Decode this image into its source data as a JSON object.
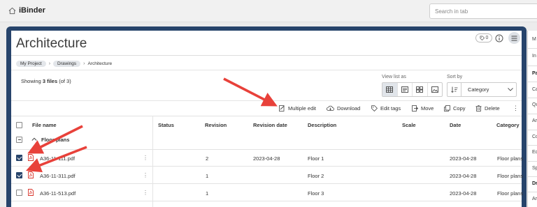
{
  "app": {
    "logo_text": "iBinder"
  },
  "search": {
    "placeholder": "Search in tab"
  },
  "page": {
    "title": "Architecture",
    "tag_count": "0"
  },
  "breadcrumb": [
    "My Project",
    "Drawings",
    "Architecture"
  ],
  "summary": {
    "prefix": "Showing ",
    "count": "3 files",
    "suffix": " (of 3)"
  },
  "view": {
    "label": "View list as"
  },
  "sort": {
    "label": "Sort by",
    "value": "Category"
  },
  "toolbar": {
    "multiple_edit": "Multiple edit",
    "download": "Download",
    "edit_tags": "Edit tags",
    "move": "Move",
    "copy": "Copy",
    "delete": "Delete"
  },
  "table": {
    "headers": {
      "file_name": "File name",
      "status": "Status",
      "revision": "Revision",
      "revision_date": "Revision date",
      "description": "Description",
      "scale": "Scale",
      "date": "Date",
      "category": "Category"
    },
    "group": "Floor plans",
    "rows": [
      {
        "file": "A36-11-111.pdf",
        "status": "",
        "revision": "2",
        "revision_date": "2023-04-28",
        "description": "Floor 1",
        "scale": "",
        "date": "2023-04-28",
        "category": "Floor plans",
        "checked": true
      },
      {
        "file": "A36-11-311.pdf",
        "status": "",
        "revision": "1",
        "revision_date": "",
        "description": "Floor 2",
        "scale": "",
        "date": "2023-04-28",
        "category": "Floor plans",
        "checked": true
      },
      {
        "file": "A36-11-513.pdf",
        "status": "",
        "revision": "1",
        "revision_date": "",
        "description": "Floor 3",
        "scale": "",
        "date": "2023-04-28",
        "category": "Floor plans",
        "checked": false
      }
    ]
  },
  "right_panel": {
    "items": [
      "M",
      "In",
      "Pa",
      "Ca",
      "Qu",
      "Ar",
      "Co",
      "Ec",
      "Sp",
      "Dr",
      "Ar"
    ]
  },
  "colors": {
    "frame": "#27446b",
    "annotation_arrow": "#e8413a",
    "pdf_red": "#d9342b"
  }
}
